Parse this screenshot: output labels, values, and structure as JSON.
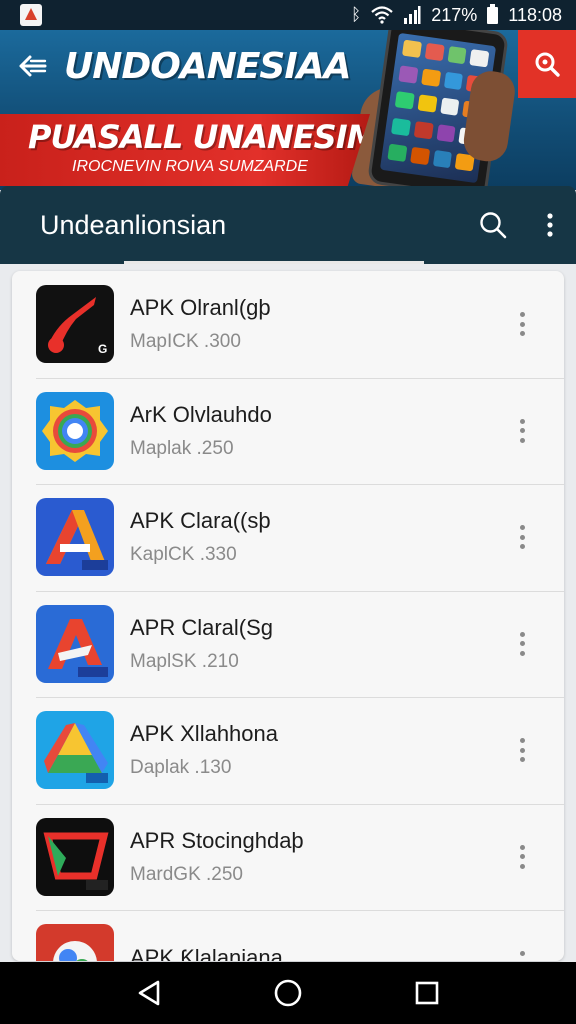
{
  "status_bar": {
    "indicators": "ᛒ",
    "battery": "217%",
    "time": "118:08"
  },
  "banner": {
    "title": "UNDOANESIAA",
    "promo_title": "PUASALL UNANESIM",
    "promo_subtitle": "IROCNEVIN ROIVA SUMZARDE"
  },
  "toolbar": {
    "title": "Undeanlionsian"
  },
  "apps": [
    {
      "name": "APK Olranl(ɡþ",
      "meta": "MapICK .300",
      "icon": "music-note-icon",
      "color": "#111111"
    },
    {
      "name": "ArK Olvlauhdo",
      "meta": "Maplak .250",
      "icon": "camera-lens-icon",
      "color": "#1d8fe0"
    },
    {
      "name": "APK Clara((sþ",
      "meta": "KaplCK .330",
      "icon": "letter-a-icon",
      "color": "#2a5bd0"
    },
    {
      "name": "APR Claral(Sɡ",
      "meta": "MaplSK .210",
      "icon": "letter-a-red-icon",
      "color": "#2a6bd6"
    },
    {
      "name": "APK Xllahhona",
      "meta": "Daplak .130",
      "icon": "triangle-drive-icon",
      "color": "#1fa4e6"
    },
    {
      "name": "APR Stocinghdaþ",
      "meta": "MardGK .250",
      "icon": "square-frame-icon",
      "color": "#0e0e0e"
    },
    {
      "name": "APK Ƙlalaniana",
      "meta": "",
      "icon": "circle-logo-icon",
      "color": "#d33a2c"
    }
  ],
  "colors": {
    "status_bar": "#0f2230",
    "toolbar": "#163645",
    "banner_blue": "#1b6a9c",
    "banner_red": "#e2302a",
    "nav_bar": "#000000"
  }
}
